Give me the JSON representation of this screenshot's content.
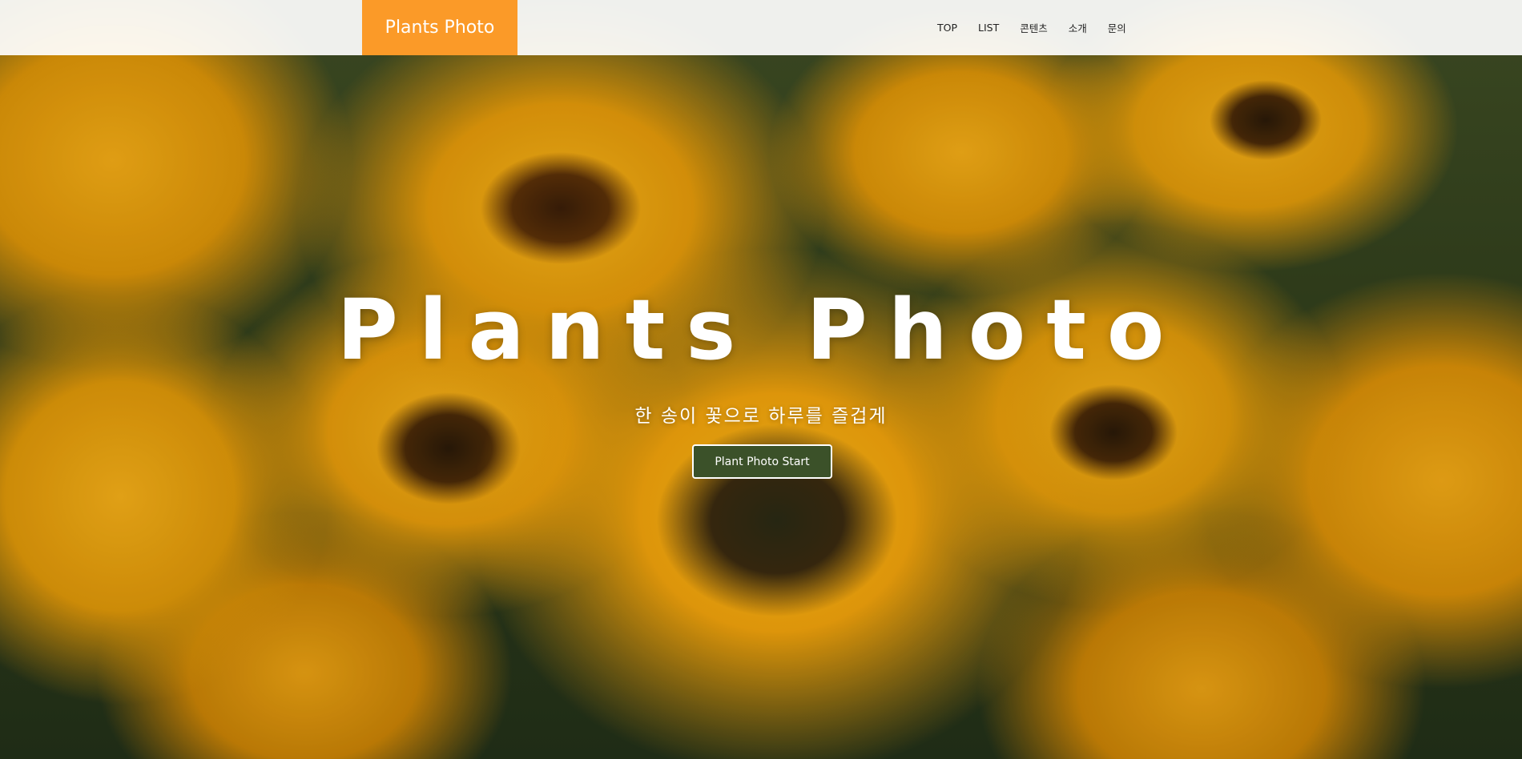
{
  "header": {
    "logo": "Plants Photo",
    "nav": [
      "TOP",
      "LIST",
      "콘텐츠",
      "소개",
      "문의"
    ]
  },
  "hero": {
    "title": "Plants Photo",
    "subtitle": "한 송이 꽃으로 하루를 즐겁게",
    "cta_label": "Plant Photo Start"
  },
  "colors": {
    "logo_bg": "#fb9a28",
    "cta_bg": "#3b5129",
    "header_bg": "#ffffff"
  }
}
